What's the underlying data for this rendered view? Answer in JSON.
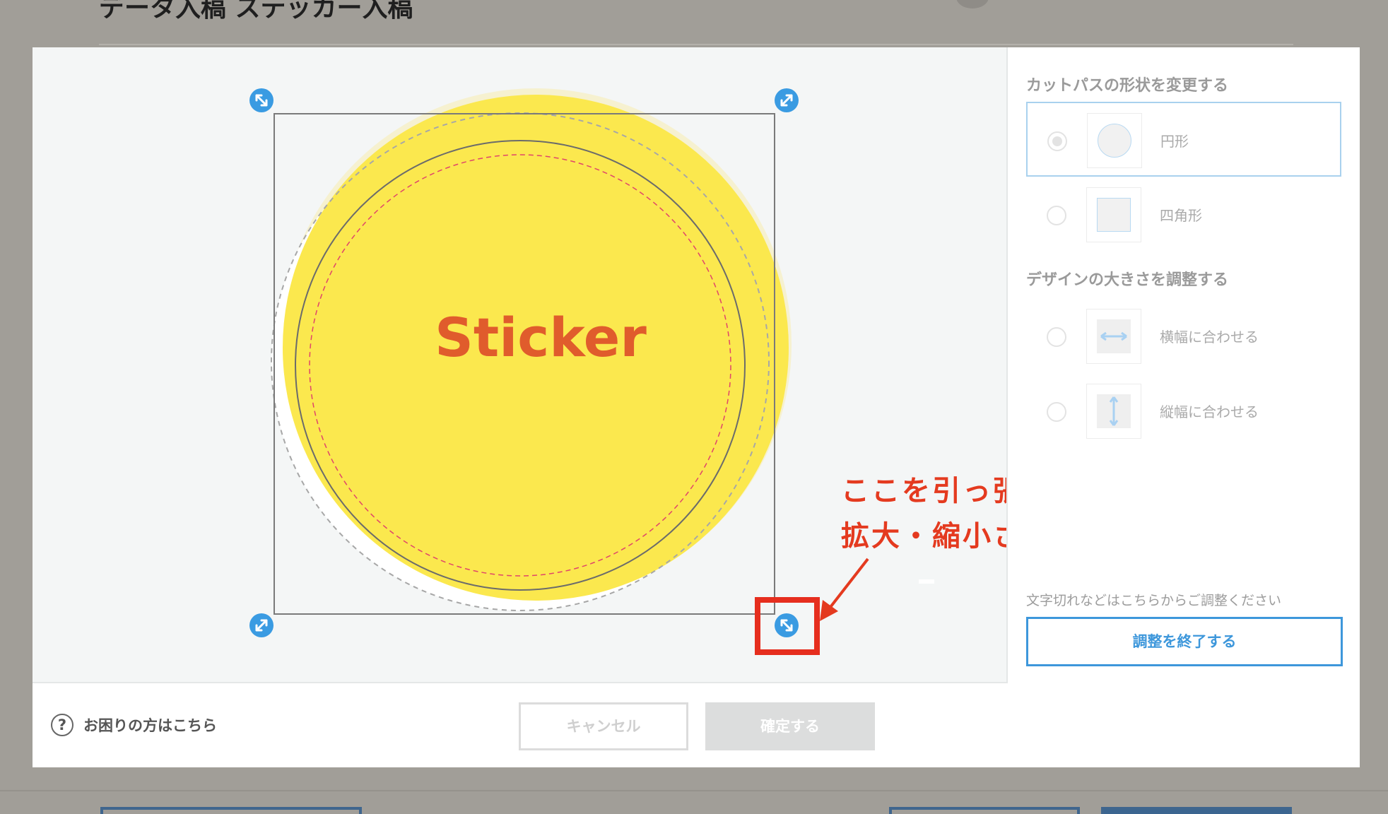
{
  "background": {
    "title": "データ入稿 ステッカー入稿"
  },
  "canvas": {
    "design_text": "Sticker",
    "colors": {
      "fill": "#fbe84e",
      "pale_fill": "#f6f1d0",
      "text": "#e05c2c",
      "handle": "#3a9be2"
    }
  },
  "annotation": {
    "line1": "ここを引っ張ると",
    "line2": "拡大・縮小されます",
    "color": "#e43a1f"
  },
  "panel": {
    "cutpath_title": "カットパスの形状を変更する",
    "cutpath_options": [
      {
        "label": "円形",
        "selected": true,
        "icon": "circle-shape-icon"
      },
      {
        "label": "四角形",
        "selected": false,
        "icon": "square-shape-icon"
      }
    ],
    "size_title": "デザインの大きさを調整する",
    "size_options": [
      {
        "label": "横幅に合わせる",
        "icon": "fit-width-icon"
      },
      {
        "label": "縦幅に合わせる",
        "icon": "fit-height-icon"
      }
    ],
    "note": "文字切れなどはこちらからご調整ください",
    "finish_label": "調整を終了する"
  },
  "footer": {
    "help_icon": "?",
    "help_text": "お困りの方はこちら",
    "cancel_label": "キャンセル",
    "confirm_label": "確定する"
  }
}
